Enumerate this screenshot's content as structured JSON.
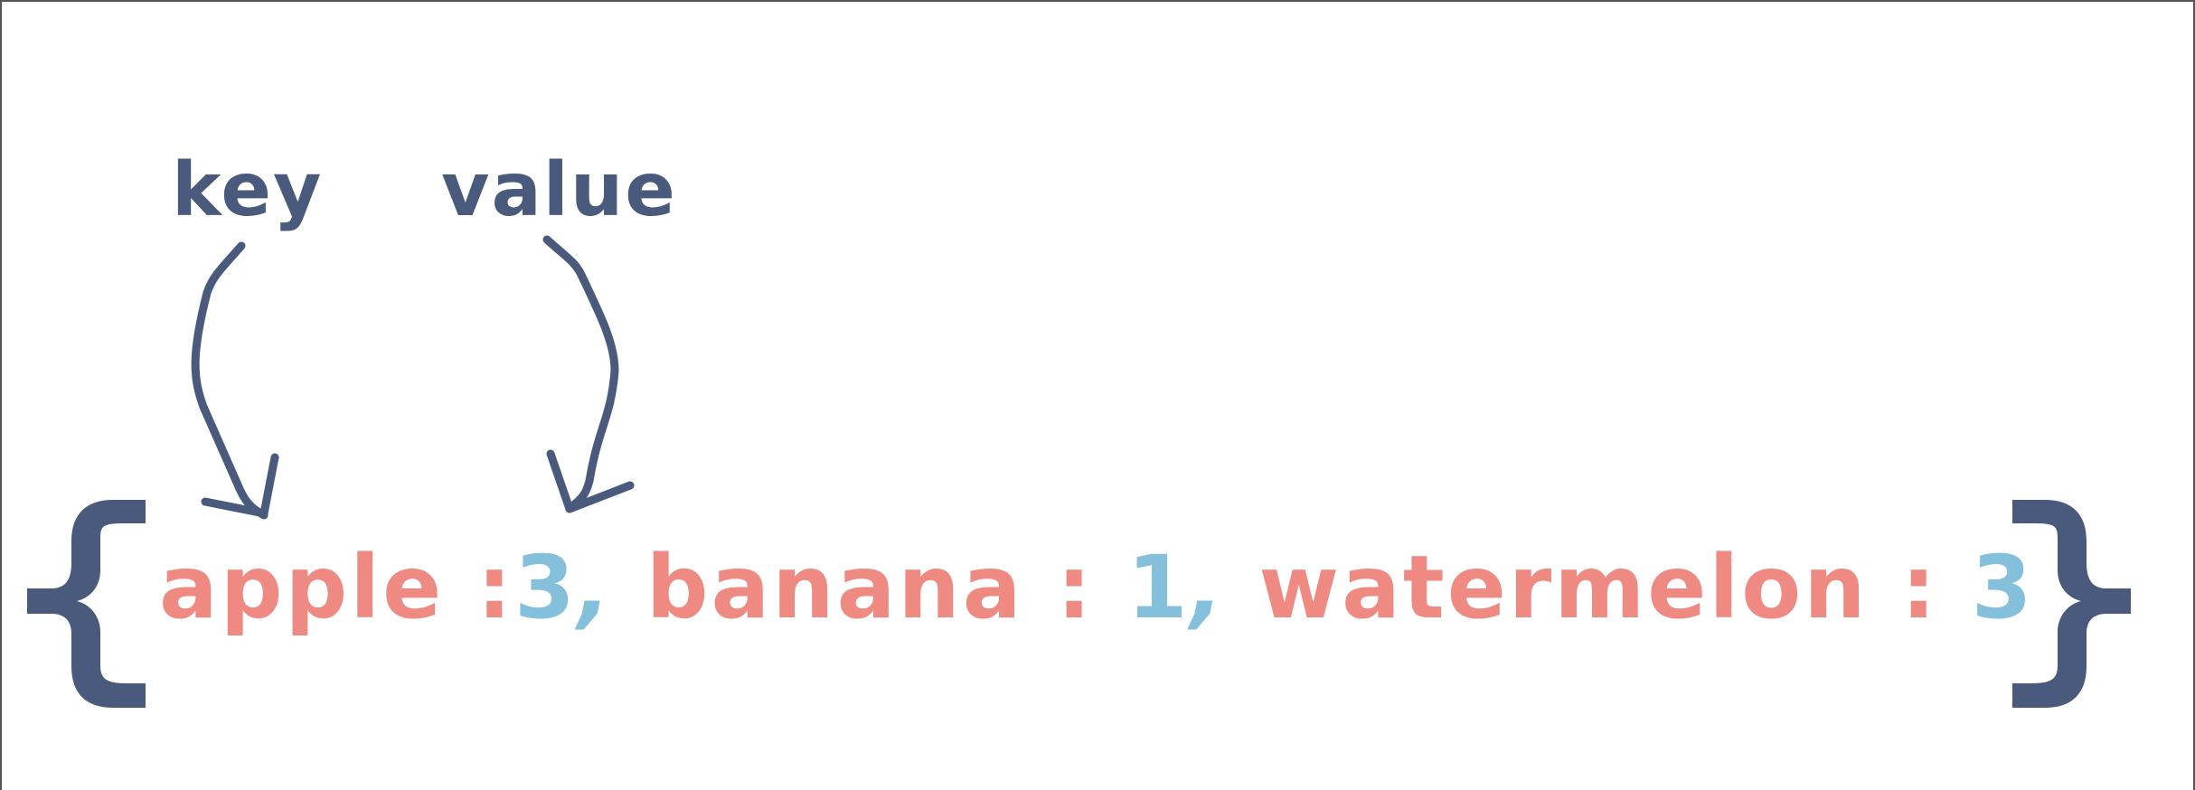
{
  "labels": {
    "key": "key",
    "value": "value"
  },
  "dictionary": {
    "open_brace": "{",
    "close_brace": "}",
    "entries": [
      {
        "key": "apple",
        "separator": " :",
        "value": "3",
        "comma": ","
      },
      {
        "key": "banana",
        "separator": " : ",
        "value": "1",
        "comma": ","
      },
      {
        "key": "watermelon",
        "separator": " : ",
        "value": "3",
        "comma": ""
      }
    ]
  },
  "colors": {
    "key_color": "#ee8a82",
    "value_color": "#84bfdc",
    "brace_color": "#4a5a7c",
    "label_color": "#4a5a7c",
    "arrow_color": "#4a5a7c"
  }
}
